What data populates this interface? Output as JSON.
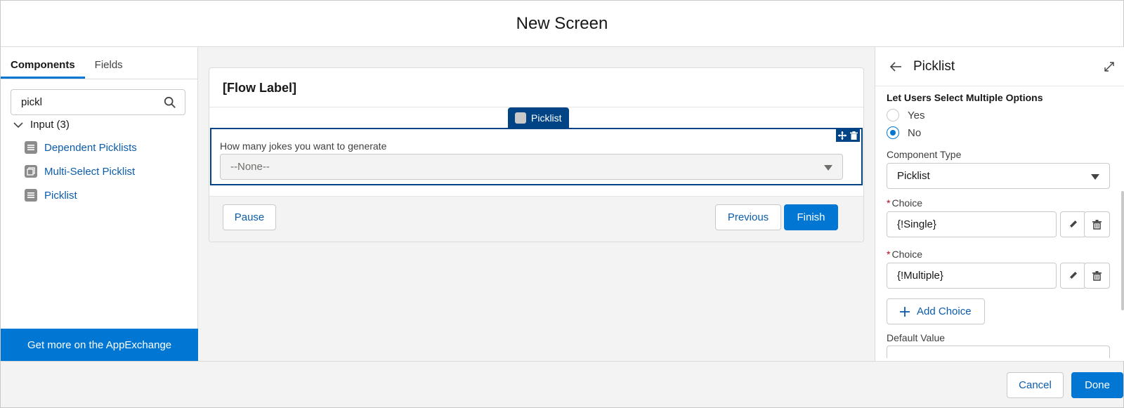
{
  "header": {
    "title": "New Screen"
  },
  "left": {
    "tabs": [
      {
        "label": "Components"
      },
      {
        "label": "Fields"
      }
    ],
    "search": {
      "value": "pickl"
    },
    "tree": {
      "group_label": "Input (3)",
      "items": [
        {
          "label": "Dependent Picklists",
          "icon": "list-icon"
        },
        {
          "label": "Multi-Select Picklist",
          "icon": "multi-list-icon"
        },
        {
          "label": "Picklist",
          "icon": "list-icon"
        }
      ]
    },
    "appexchange_label": "Get more on the AppExchange"
  },
  "canvas": {
    "card_title": "[Flow Label]",
    "component_tag": "Picklist",
    "field_label": "How many jokes you want to generate",
    "field_value": "--None--",
    "buttons": {
      "pause": "Pause",
      "previous": "Previous",
      "finish": "Finish"
    }
  },
  "right": {
    "title": "Picklist",
    "multi_select_label": "Let Users Select Multiple Options",
    "options": [
      {
        "label": "Yes",
        "selected": false
      },
      {
        "label": "No",
        "selected": true
      }
    ],
    "component_type_label": "Component Type",
    "component_type_value": "Picklist",
    "choices": [
      {
        "label": "Choice",
        "required_mark": "*",
        "value": "{!Single}"
      },
      {
        "label": "Choice",
        "required_mark": "*",
        "value": "{!Multiple}"
      }
    ],
    "add_choice_label": "Add Choice",
    "default_value_label": "Default Value"
  },
  "footer": {
    "cancel": "Cancel",
    "done": "Done"
  },
  "colors": {
    "brand": "#0176d3",
    "selection": "#014486",
    "link": "#0b5cab",
    "required": "#ba0517"
  }
}
